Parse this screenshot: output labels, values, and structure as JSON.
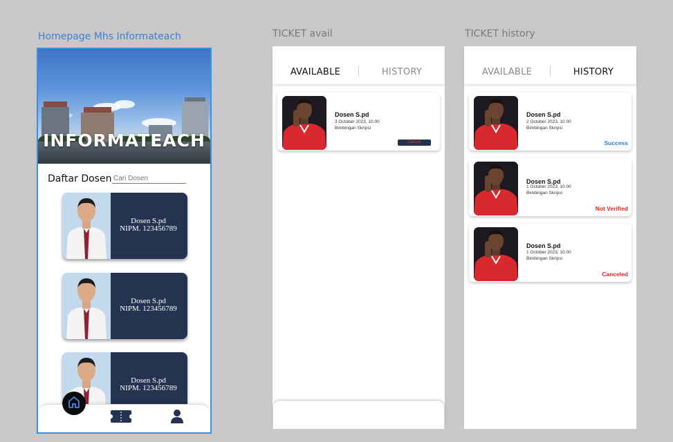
{
  "frames": {
    "home": {
      "label": "Homepage Mhs Informateach",
      "hero_title": "INFORMATEACH",
      "section_title": "Daftar Dosen",
      "search_placeholder": "Cari Dosen",
      "lecturers": [
        {
          "name": "Dosen S.pd",
          "nipm": "NIPM. 123456789"
        },
        {
          "name": "Dosen S.pd",
          "nipm": "NIPM. 123456789"
        },
        {
          "name": "Dosen S.pd",
          "nipm": "NIPM. 123456789"
        }
      ],
      "nav": {
        "home_icon": "home-icon",
        "ticket_icon": "ticket-icon",
        "profile_icon": "user-icon"
      }
    },
    "ticket_avail": {
      "label": "TICKET avail",
      "tabs": [
        "AVAILABLE",
        "HISTORY"
      ],
      "active_tab": "AVAILABLE",
      "tickets": [
        {
          "name": "Dosen S.pd",
          "date": "3 October 2023, 10.00",
          "topic": "Bimbingan Skripsi",
          "action": "Cancel"
        }
      ]
    },
    "ticket_history": {
      "label": "TICKET history",
      "tabs": [
        "AVAILABLE",
        "HISTORY"
      ],
      "active_tab": "HISTORY",
      "tickets": [
        {
          "name": "Dosen S.pd",
          "date": "2 October 2023, 10.00",
          "topic": "Bimbingan Skripsi",
          "status": "Success",
          "status_color": "#2f80d6"
        },
        {
          "name": "Dosen S.pd",
          "date": "1 October 2023, 10.00",
          "topic": "Bimbingan Skripsi",
          "status": "Not Verified",
          "status_color": "#e02424"
        },
        {
          "name": "Dosen S.pd",
          "date": "1 October 2023, 10.00",
          "topic": "Bimbingan Skripsi",
          "status": "Canceled",
          "status_color": "#e02424"
        }
      ]
    }
  },
  "colors": {
    "canvas": "#c9c7c8",
    "card_navy": "#233350",
    "selection_blue": "#3a8fe0",
    "success": "#2f80d6",
    "danger": "#e02424"
  }
}
